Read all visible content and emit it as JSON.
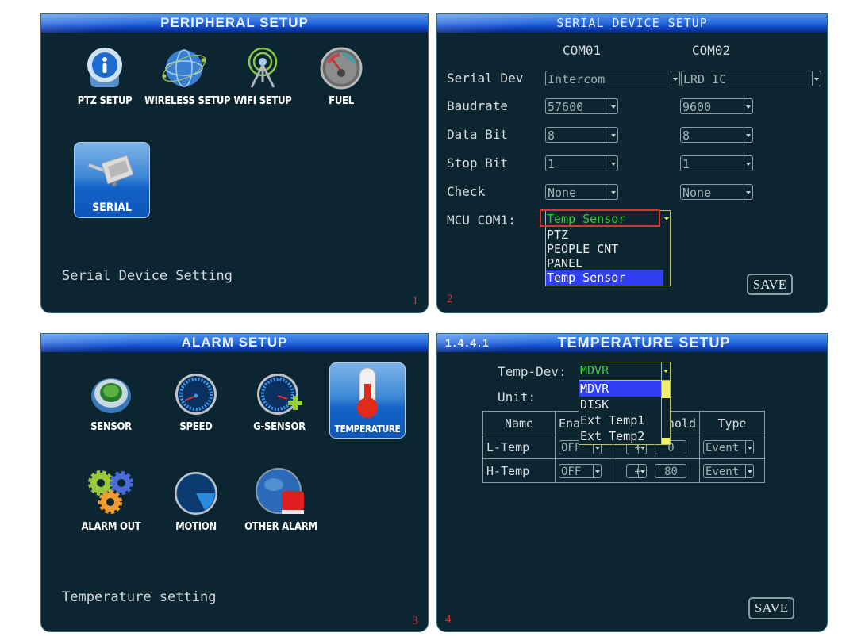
{
  "panels": {
    "p1": {
      "title": "PERIPHERAL  SETUP",
      "icons": [
        {
          "label": "PTZ SETUP",
          "icon": "ptz-camera-icon"
        },
        {
          "label": "WIRELESS SETUP",
          "icon": "globe-network-icon"
        },
        {
          "label": "WIFI SETUP",
          "icon": "wifi-antenna-icon"
        },
        {
          "label": "FUEL",
          "icon": "fuel-gauge-icon"
        }
      ],
      "selected_tile": {
        "label": "SERIAL",
        "icon": "serial-connector-icon"
      },
      "description": "Serial Device Setting",
      "step_number": "1"
    },
    "p2": {
      "title": "SERIAL DEVICE SETUP",
      "columns": [
        "COM01",
        "COM02"
      ],
      "rows": [
        {
          "label": "Serial Dev",
          "com01": "Intercom",
          "com02": "LRD IC"
        },
        {
          "label": "Baudrate",
          "com01": "57600",
          "com02": "9600"
        },
        {
          "label": "Data Bit",
          "com01": "8",
          "com02": "8"
        },
        {
          "label": "Stop Bit",
          "com01": "1",
          "com02": "1"
        },
        {
          "label": "Check",
          "com01": "None",
          "com02": "None"
        }
      ],
      "mcu_label": "MCU COM1:",
      "mcu_value": "Temp Sensor",
      "mcu_options": [
        "PTZ",
        "PEOPLE CNT",
        "PANEL",
        "Temp Sensor"
      ],
      "mcu_highlighted": "Temp Sensor",
      "save_label": "SAVE",
      "step_number": "2"
    },
    "p3": {
      "title": "ALARM  SETUP",
      "icons": [
        {
          "label": "SENSOR",
          "icon": "sensor-icon"
        },
        {
          "label": "SPEED",
          "icon": "speedometer-icon"
        },
        {
          "label": "G-SENSOR",
          "icon": "g-sensor-icon"
        },
        {
          "label": "TEMPERATURE",
          "icon": "thermometer-icon",
          "selected": true
        },
        {
          "label": "ALARM OUT",
          "icon": "gears-icon"
        },
        {
          "label": "MOTION",
          "icon": "radar-icon"
        },
        {
          "label": "OTHER ALARM",
          "icon": "globe-alarm-icon"
        }
      ],
      "description": "Temperature setting",
      "step_number": "3"
    },
    "p4": {
      "menu_number": "1.4.4.1",
      "title": "TEMPERATURE  SETUP",
      "temp_dev_label": "Temp-Dev:",
      "temp_dev_value": "MDVR",
      "temp_dev_options": [
        "MDVR",
        "DISK",
        "Ext Temp1",
        "Ext Temp2"
      ],
      "temp_dev_highlighted": "MDVR",
      "unit_label": "Unit:",
      "table": {
        "headers": [
          "Name",
          "Enable",
          "Threshold",
          "Type"
        ],
        "rows": [
          {
            "name": "L-Temp",
            "enable": "OFF",
            "sign": "+",
            "value": "0",
            "type": "Event"
          },
          {
            "name": "H-Temp",
            "enable": "OFF",
            "sign": "+",
            "value": "80",
            "type": "Event"
          }
        ]
      },
      "save_label": "SAVE",
      "step_number": "4"
    }
  },
  "colors": {
    "panel_bg": "#0b2630",
    "header_blue": "#1148c8",
    "highlight": "#2e3ef0",
    "focus_red": "#e03030",
    "value_green": "#3ac83a",
    "step_number_red": "#e0303a"
  }
}
